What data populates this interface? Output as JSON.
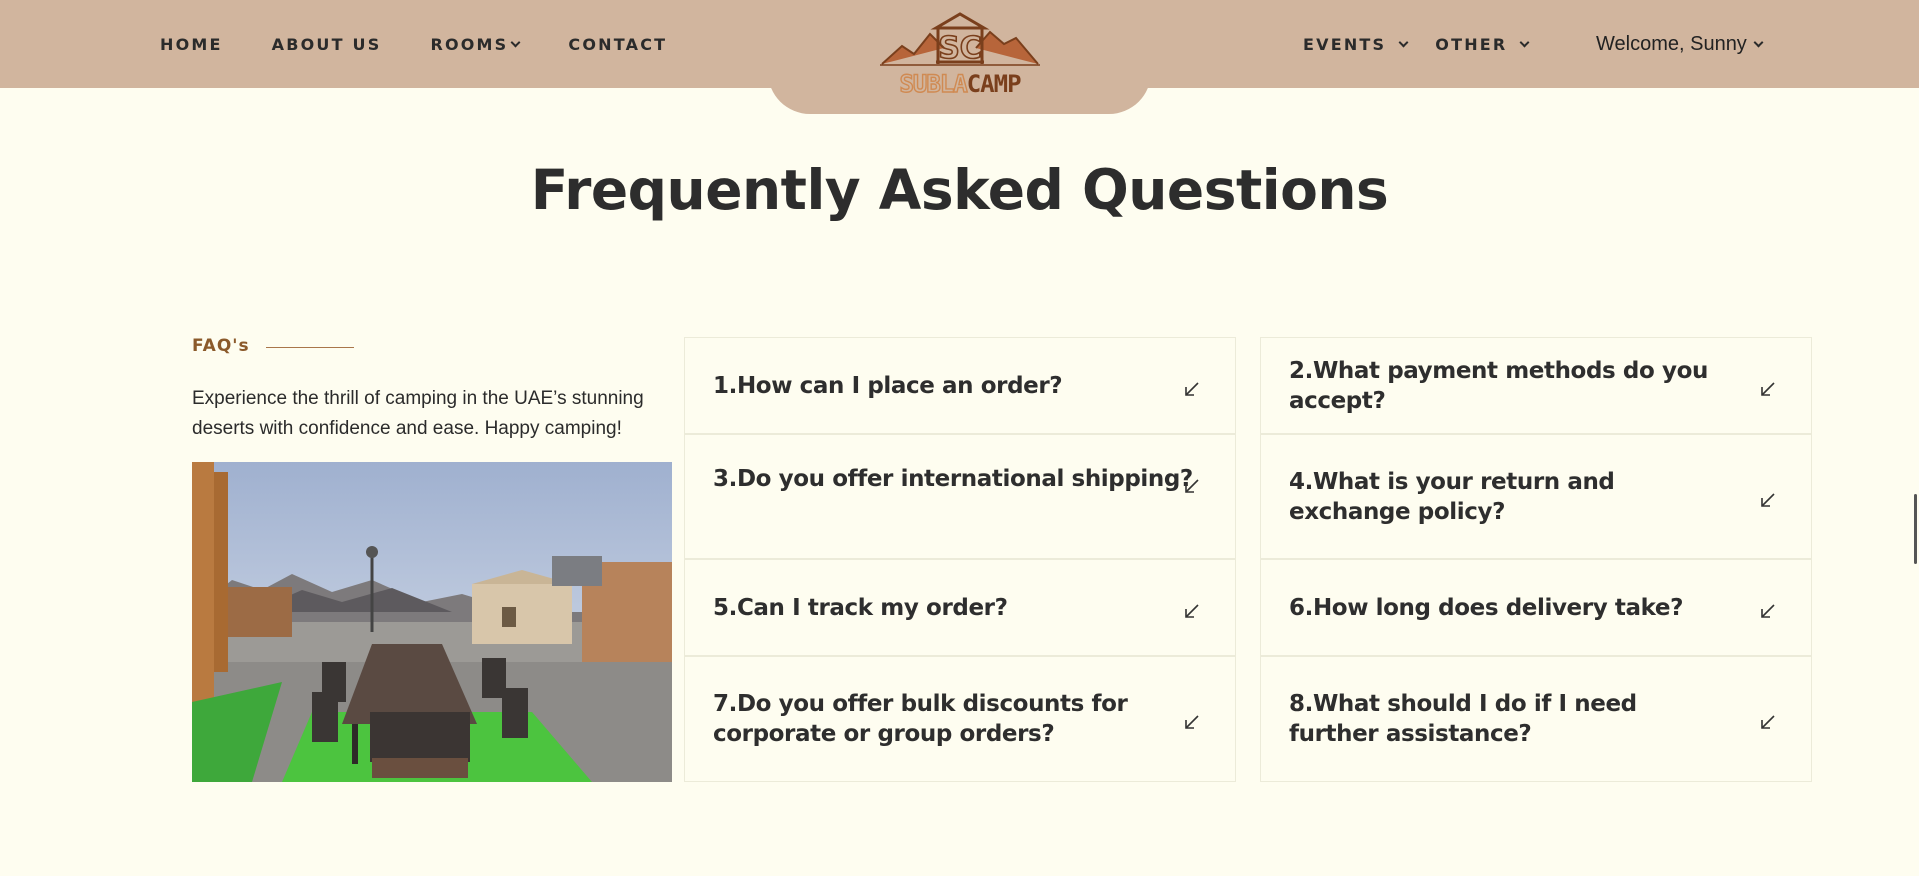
{
  "nav": {
    "left": [
      {
        "label": "HOME",
        "has_dropdown": false
      },
      {
        "label": "ABOUT US",
        "has_dropdown": false
      },
      {
        "label": "ROOMS",
        "has_dropdown": true
      },
      {
        "label": "CONTACT",
        "has_dropdown": false
      }
    ],
    "right": [
      {
        "label": "EVENTS",
        "has_dropdown": true
      },
      {
        "label": "OTHER",
        "has_dropdown": true
      }
    ],
    "welcome": "Welcome, Sunny"
  },
  "logo": {
    "monogram": "SC",
    "word_left": "SUBLA",
    "word_right": "CAMP",
    "color_left": "#d08a52",
    "color_right": "#7a3f1c"
  },
  "page_title": "Frequently Asked Questions",
  "intro": {
    "label": "FAQ's",
    "text": "Experience the thrill of camping in the UAE’s stunning deserts with confidence and ease. Happy camping!"
  },
  "faq": [
    {
      "question": "1.How can I place an order?"
    },
    {
      "question": "2.What payment methods do you accept?"
    },
    {
      "question": "3.Do you offer international shipping?"
    },
    {
      "question": "4.What is your return and exchange policy?"
    },
    {
      "question": "5.Can I track my order?"
    },
    {
      "question": "6.How long does delivery take?"
    },
    {
      "question": "7.Do you offer bulk discounts for corporate or group orders?"
    },
    {
      "question": "8.What should I do if I need further assistance?"
    }
  ],
  "colors": {
    "header_bg": "#d1b59e",
    "page_bg": "#fefdf0",
    "accent_brown": "#8b5a2b"
  },
  "icons": {
    "faq_toggle": "arrow-down-left-icon",
    "dropdown": "chevron-down-icon"
  }
}
